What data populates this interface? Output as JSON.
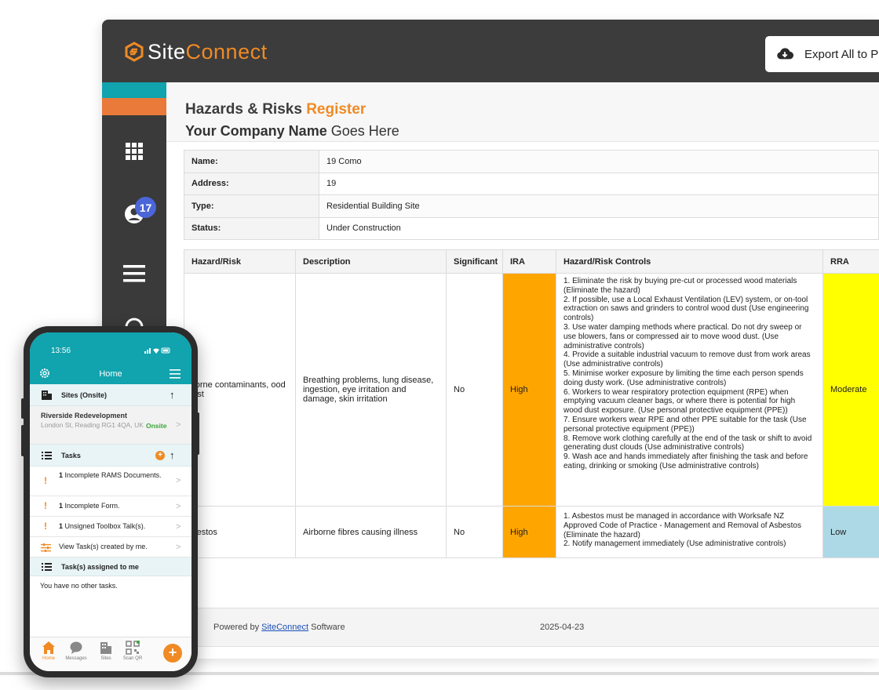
{
  "app": {
    "brand_part1": "Site",
    "brand_part2": "Connect",
    "export_label": "Export All to P",
    "notification_count": "17"
  },
  "report": {
    "title_part1": "Hazards & Risks",
    "title_part2": "Register",
    "company_bold": "Your Company Name",
    "company_rest": "Goes Here",
    "info": [
      {
        "label": "Name:",
        "value": "19 Como"
      },
      {
        "label": "Address:",
        "value": "19"
      },
      {
        "label": "Type:",
        "value": "Residential Building Site"
      },
      {
        "label": "Status:",
        "value": "Under Construction"
      }
    ],
    "columns": {
      "hazard": "Hazard/Risk",
      "description": "Description",
      "significant": "Significant",
      "ira": "IRA",
      "controls": "Hazard/Risk Controls",
      "rra": "RRA"
    },
    "rows": [
      {
        "hazard": "rborne contaminants, ood dust",
        "description": "Breathing problems, lung disease, ingestion, eye irritation and damage, skin irritation",
        "significant": "No",
        "ira": "High",
        "controls": [
          "1. Eliminate the risk by buying pre-cut or processed wood materials (Eliminate the hazard)",
          "2. If possible, use a Local Exhaust Ventilation (LEV) system, or on-tool extraction on saws and grinders to control wood dust (Use engineering controls)",
          "3. Use water damping methods where practical. Do not dry sweep or use blowers, fans or compressed air to move wood dust. (Use administrative controls)",
          "4. Provide a suitable industrial vacuum to remove dust from work areas (Use administrative controls)",
          "5. Minimise worker exposure by limiting the time each person spends doing dusty work. (Use administrative controls)",
          "6. Workers to wear respiratory protection equipment (RPE) when emptying vacuum cleaner bags, or where there is potential for high wood dust exposure. (Use personal protective equipment (PPE))",
          "7. Ensure workers wear RPE and other PPE suitable for the task (Use personal protective equipment (PPE))",
          "8. Remove work clothing carefully at the end of the task or shift to avoid generating dust clouds (Use administrative controls)",
          "9. Wash ace and hands immediately after finishing the task and before eating, drinking or smoking (Use administrative controls)"
        ],
        "rra": "Moderate"
      },
      {
        "hazard": "sbestos",
        "description": "Airborne fibres causing illness",
        "significant": "No",
        "ira": "High",
        "controls": [
          "1. Asbestos must be managed in accordance with Worksafe NZ Approved Code of Practice - Management and Removal of Asbestos (Eliminate the hazard)",
          "2. Notify management immediately (Use administrative controls)"
        ],
        "rra": "Low"
      }
    ],
    "footer": {
      "powered_prefix": "Powered by",
      "powered_link": "SiteConnect",
      "powered_suffix": "Software",
      "date": "2025-04-23"
    },
    "risk_colors": {
      "high": "#ffa500",
      "moderate": "#ffff00",
      "low": "#add8e6"
    }
  },
  "phone": {
    "time": "13:56",
    "header_title": "Home",
    "sites_section": "Sites (Onsite)",
    "site_name": "Riverside Redevelopment",
    "site_address": "London St, Reading RG1 4QA, UK",
    "site_status": "Onsite",
    "tasks_section": "Tasks",
    "tasks": [
      {
        "count": "1",
        "text": "Incomplete RAMS Documents."
      },
      {
        "count": "1",
        "text": "Incomplete Form."
      },
      {
        "count": "1",
        "text": "Unsigned Toolbox Talk(s)."
      }
    ],
    "view_tasks": "View Task(s) created by me.",
    "assigned_section": "Task(s) assigned to me",
    "no_tasks": "You have no other tasks.",
    "nav": [
      "Home",
      "Messages",
      "Sites",
      "Scan QR"
    ],
    "accent": "#11a3ae",
    "orange": "#f08a24"
  }
}
